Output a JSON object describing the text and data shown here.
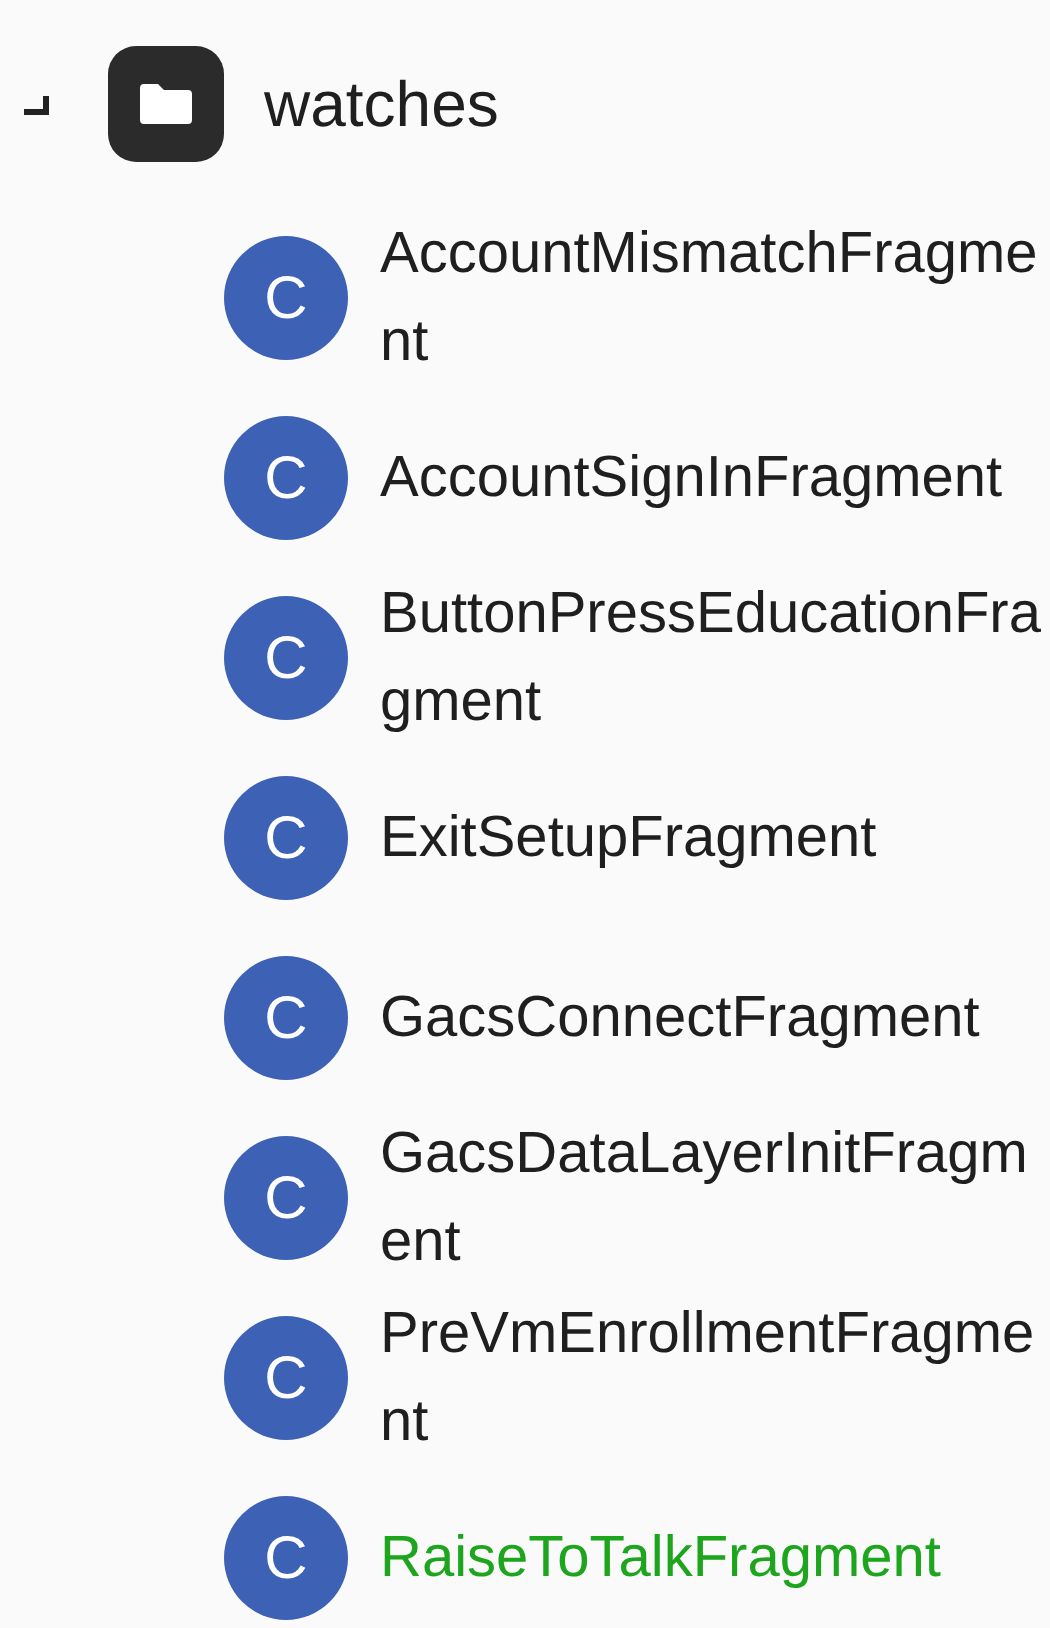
{
  "folder": {
    "name": "watches",
    "expanded": true
  },
  "items": [
    {
      "letter": "C",
      "name": "AccountMismatchFragment",
      "selected": false
    },
    {
      "letter": "C",
      "name": "AccountSignInFragment",
      "selected": false
    },
    {
      "letter": "C",
      "name": "ButtonPressEducationFragment",
      "selected": false
    },
    {
      "letter": "C",
      "name": "ExitSetupFragment",
      "selected": false
    },
    {
      "letter": "C",
      "name": "GacsConnectFragment",
      "selected": false
    },
    {
      "letter": "C",
      "name": "GacsDataLayerInitFragment",
      "selected": false
    },
    {
      "letter": "C",
      "name": "PreVmEnrollmentFragment",
      "selected": false
    },
    {
      "letter": "C",
      "name": "RaiseToTalkFragment",
      "selected": true
    }
  ]
}
